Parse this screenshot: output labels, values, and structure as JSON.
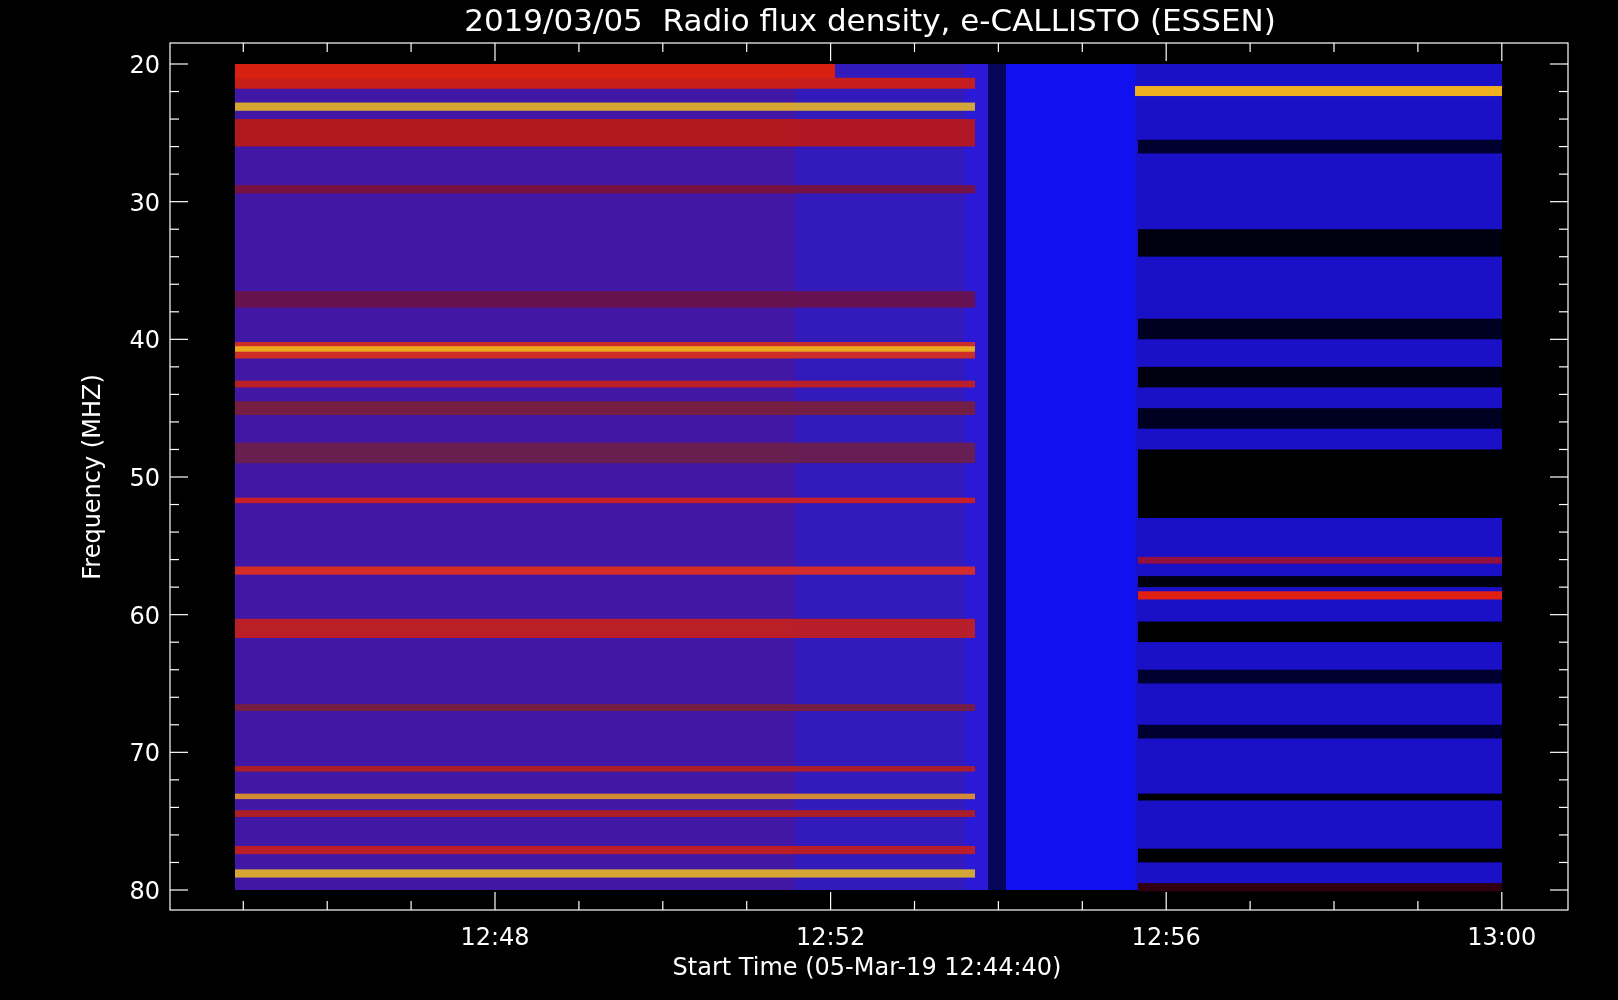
{
  "title": "2019/03/05  Radio flux density, e-CALLISTO (ESSEN)",
  "y_axis": {
    "label": "Frequency (MHZ)",
    "ticks": [
      "20",
      "30",
      "40",
      "50",
      "60",
      "70",
      "80"
    ]
  },
  "x_axis": {
    "label": "Start Time (05-Mar-19 12:44:40)",
    "ticks": [
      "12:48",
      "12:52",
      "12:56",
      "13:00"
    ]
  }
}
